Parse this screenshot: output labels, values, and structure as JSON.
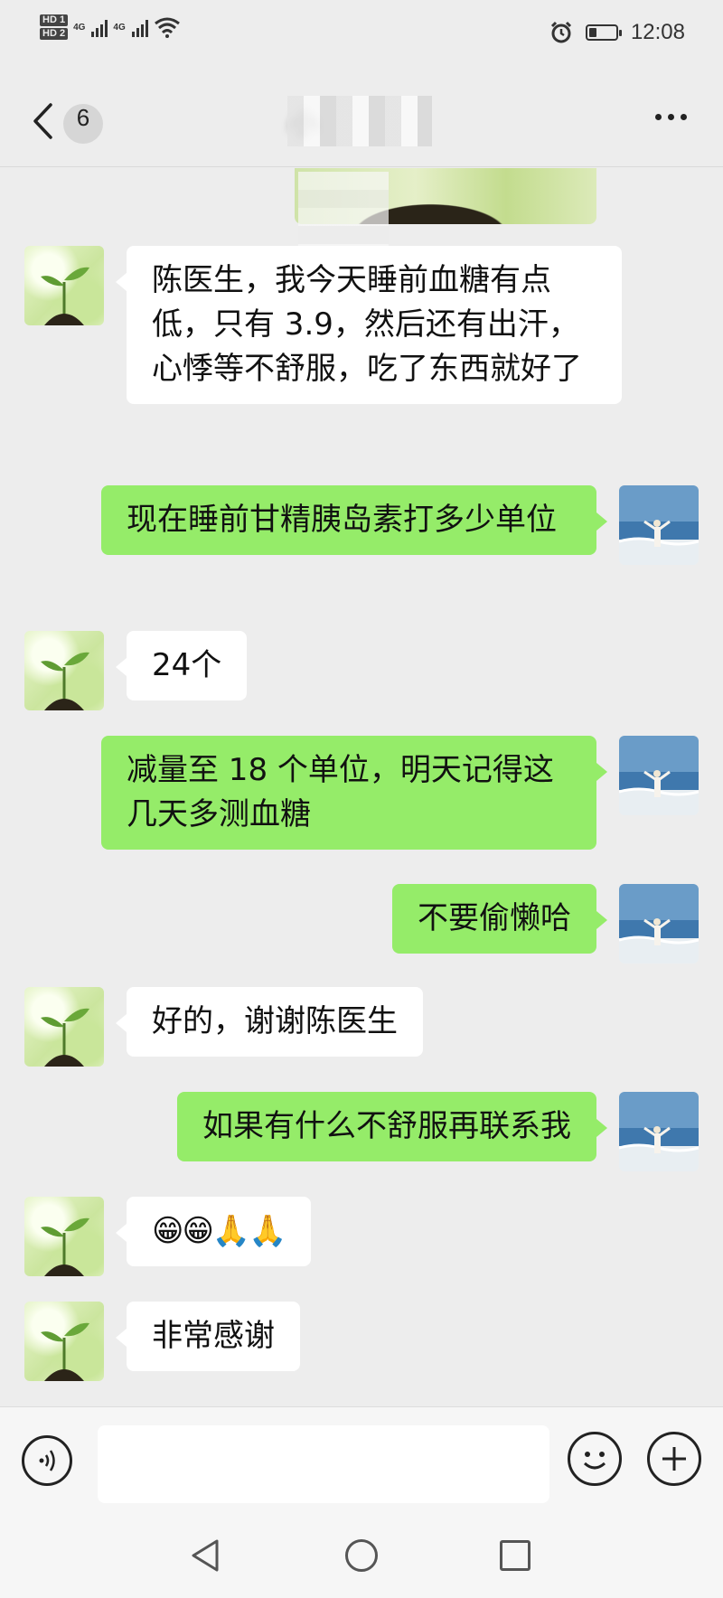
{
  "status_bar": {
    "hd1": "HD 1",
    "hd2": "HD 2",
    "net1": "4G",
    "net2": "4G",
    "time": "12:08",
    "icons": [
      "hd-sim1-icon",
      "hd-sim2-icon",
      "signal-4g-icon",
      "signal-4g-icon",
      "wifi-icon",
      "alarm-icon",
      "battery-icon"
    ],
    "battery_level": 0.3
  },
  "header": {
    "unread_count": "6",
    "title": "小 ",
    "icons": [
      "back-chevron-icon",
      "more-dots-icon"
    ]
  },
  "messages": [
    {
      "side": "left",
      "avatar": "plant-avatar",
      "text": "陈医生，我今天睡前血糖有点低，只有 3.9，然后还有出汗，心悸等不舒服，吃了东西就好了"
    },
    {
      "side": "right",
      "avatar": "beach-avatar",
      "text": "现在睡前甘精胰岛素打多少单位"
    },
    {
      "side": "left",
      "avatar": "plant-avatar",
      "text": "24个"
    },
    {
      "side": "right",
      "avatar": "beach-avatar",
      "text": "减量至 18 个单位，明天记得这几天多测血糖"
    },
    {
      "side": "right",
      "avatar": "beach-avatar",
      "text": "不要偷懒哈"
    },
    {
      "side": "left",
      "avatar": "plant-avatar",
      "text": "好的，谢谢陈医生"
    },
    {
      "side": "right",
      "avatar": "beach-avatar",
      "text": "如果有什么不舒服再联系我"
    },
    {
      "side": "left",
      "avatar": "plant-avatar",
      "text": "😁😁🙏🙏"
    },
    {
      "side": "left",
      "avatar": "plant-avatar",
      "text": "非常感谢"
    }
  ],
  "input_bar": {
    "value": "",
    "icons": [
      "voice-icon",
      "emoji-icon",
      "plus-icon"
    ]
  },
  "system_nav": {
    "icons": [
      "nav-back-icon",
      "nav-home-icon",
      "nav-recent-icon"
    ]
  },
  "colors": {
    "background": "#ededed",
    "sent_bubble": "#95ec69",
    "received_bubble": "#ffffff"
  }
}
